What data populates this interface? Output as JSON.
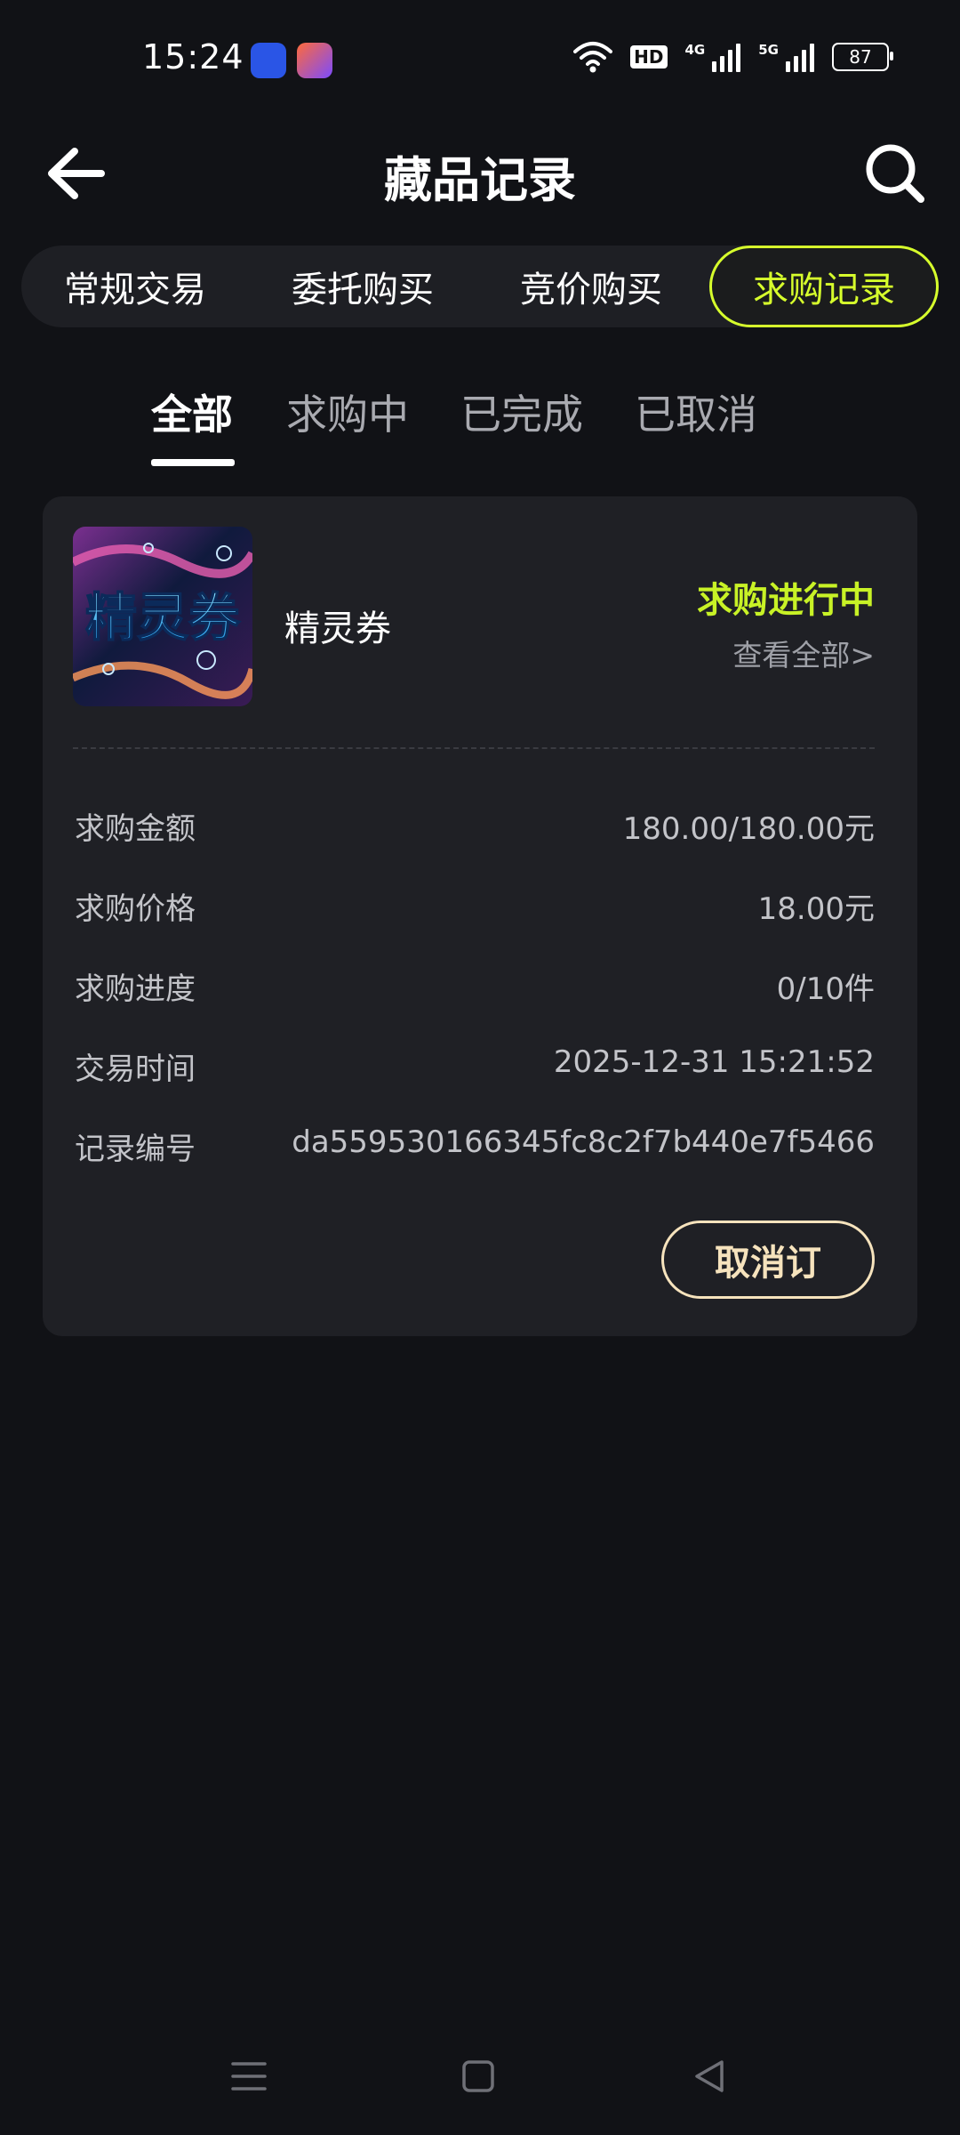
{
  "status_bar": {
    "time": "15:24",
    "icons": [
      "baidu-app-icon",
      "shortcut-app-icon",
      "wifi-icon",
      "hd-icon",
      "signal-4g-icon",
      "signal-5g-icon",
      "battery-icon"
    ],
    "hd_label": "HD",
    "sig_4g_label": "4G",
    "sig_5g_label": "5G",
    "battery_level": "87"
  },
  "header": {
    "title": "藏品记录",
    "back_icon": "arrow-left-icon",
    "search_icon": "search-icon"
  },
  "main_tabs": [
    "常规交易",
    "委托购买",
    "竞价购买",
    "求购记录"
  ],
  "main_tabs_active": "求购记录",
  "sub_tabs": [
    "全部",
    "求购中",
    "已完成",
    "已取消"
  ],
  "sub_tabs_active": "全部",
  "record": {
    "product_name": "精灵券",
    "thumbnail_text": "精灵券",
    "status": "求购进行中",
    "view_all": "查看全部>",
    "fields": [
      {
        "label": "求购金额",
        "value": "180.00/180.00元"
      },
      {
        "label": "求购价格",
        "value": "18.00元"
      },
      {
        "label": "求购进度",
        "value": "0/10件"
      },
      {
        "label": "交易时间",
        "value": "2025-12-31 15:21:52"
      },
      {
        "label": "记录编号",
        "value": "da559530166345fc8c2f7b440e7f5466"
      }
    ],
    "cancel_label": "取消订"
  },
  "colors": {
    "background": "#111216",
    "card": "#1f2025",
    "accent": "#d7ff2c",
    "status_text": "#c8f226",
    "cancel_button": "#f6e3bd"
  },
  "nav_bar": {
    "icons": [
      "menu-icon",
      "home-square-icon",
      "back-triangle-icon"
    ]
  }
}
